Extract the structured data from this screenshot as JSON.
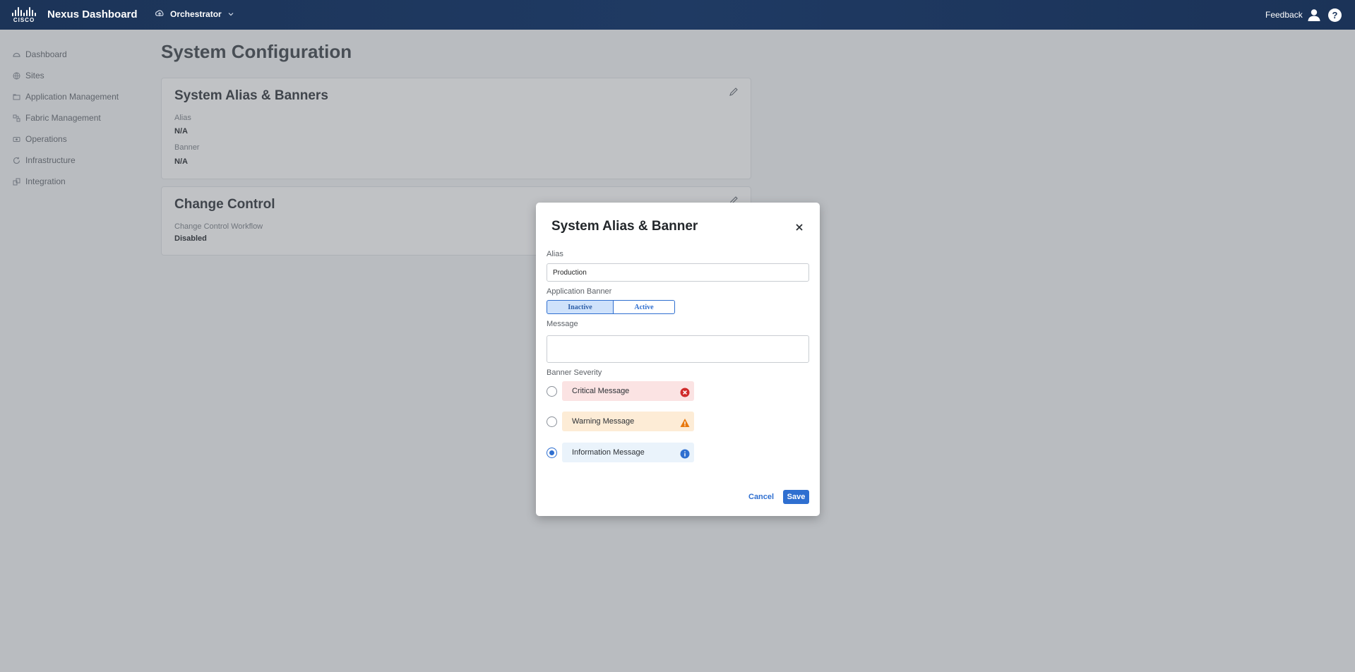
{
  "header": {
    "brand": "cisco",
    "app_title": "Nexus Dashboard",
    "context": "Orchestrator",
    "feedback": "Feedback",
    "help": "?"
  },
  "sidebar": {
    "items": [
      {
        "label": "Dashboard",
        "icon": "dashboard-icon"
      },
      {
        "label": "Sites",
        "icon": "globe-icon"
      },
      {
        "label": "Application Management",
        "icon": "folder-icon"
      },
      {
        "label": "Fabric Management",
        "icon": "fabric-icon"
      },
      {
        "label": "Operations",
        "icon": "operations-icon"
      },
      {
        "label": "Infrastructure",
        "icon": "infrastructure-icon"
      },
      {
        "label": "Integration",
        "icon": "integration-icon"
      }
    ]
  },
  "main": {
    "title": "System Configuration",
    "alias_card": {
      "title": "System Alias & Banners",
      "alias_label": "Alias",
      "alias_value": "N/A",
      "banner_label": "Banner",
      "banner_value": "N/A"
    },
    "change_card": {
      "title": "Change Control",
      "workflow_label": "Change Control Workflow",
      "workflow_value": "Disabled"
    }
  },
  "modal": {
    "title": "System Alias & Banner",
    "alias_label": "Alias",
    "alias_value": "Production",
    "banner_label": "Application Banner",
    "banner_options": [
      "Inactive",
      "Active"
    ],
    "banner_selected": "Inactive",
    "message_label": "Message",
    "message_value": "",
    "severity_label": "Banner Severity",
    "severities": [
      {
        "label": "Critical Message",
        "color": "#fbe3e3",
        "icon": "error-icon"
      },
      {
        "label": "Warning Message",
        "color": "#fdecd6",
        "icon": "warning-icon"
      },
      {
        "label": "Information Message",
        "color": "#eaf3fb",
        "icon": "info-icon"
      }
    ],
    "severity_selected": "Information Message",
    "cancel_label": "Cancel",
    "save_label": "Save"
  },
  "colors": {
    "header_bg": "#1e375e",
    "accent": "#2f6fd0",
    "critical_icon": "#d02b2b",
    "warning_icon": "#e8780c",
    "info_icon": "#2f6fd0"
  }
}
